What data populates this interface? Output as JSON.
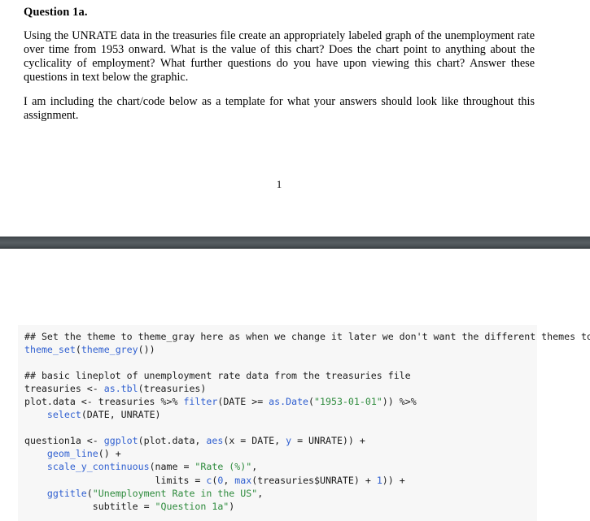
{
  "document": {
    "page_number": "1",
    "heading": "Question 1a.",
    "paragraphs": [
      "Using the UNRATE data in the treasuries file create an appropriately labeled graph of the unemployment rate over time from 1953 onward. What is the value of this chart? Does the chart point to anything about the cyclicality of employment? What further questions do you have upon viewing this chart? Answer these questions in text below the graphic.",
      "I am including the chart/code below as a template for what your answers should look like throughout this assignment."
    ]
  },
  "code_chunk": {
    "language": "r",
    "background_color": "#f7f7f7",
    "comment_color": "#1b1b1b",
    "function_color": "#2f5fd0",
    "string_color": "#2e8b3d",
    "lines": [
      "## Set the theme to theme_gray here as when we change it later we don't want the different themes to",
      "theme_set(theme_grey())",
      "",
      "## basic lineplot of unemployment rate data from the treasuries file",
      "treasuries <- as.tbl(treasuries)",
      "plot.data <- treasuries %>% filter(DATE >= as.Date(\"1953-01-01\")) %>%",
      "    select(DATE, UNRATE)",
      "",
      "question1a <- ggplot(plot.data, aes(x = DATE, y = UNRATE)) +",
      "    geom_line() +",
      "    scale_y_continuous(name = \"Rate (%)\",",
      "                       limits = c(0, max(treasuries$UNRATE) + 1)) +",
      "    ggtitle(\"Unemployment Rate in the US\",",
      "            subtitle = \"Question 1a\")"
    ],
    "tokens": {
      "line0": [
        {
          "t": "## Set the theme to theme_gray here as when we change it later we don't want the different themes to",
          "c": "tok-comment"
        }
      ],
      "line1": [
        {
          "t": "theme_set",
          "c": "tok-fn"
        },
        {
          "t": "(",
          "c": "tok-plain"
        },
        {
          "t": "theme_grey",
          "c": "tok-fn"
        },
        {
          "t": "())",
          "c": "tok-plain"
        }
      ],
      "line2": [
        {
          "t": "",
          "c": "tok-plain"
        }
      ],
      "line3": [
        {
          "t": "## basic lineplot of unemployment rate data from the treasuries file",
          "c": "tok-comment"
        }
      ],
      "line4": [
        {
          "t": "treasuries <- ",
          "c": "tok-plain"
        },
        {
          "t": "as.tbl",
          "c": "tok-fn"
        },
        {
          "t": "(treasuries)",
          "c": "tok-plain"
        }
      ],
      "line5": [
        {
          "t": "plot.data <- treasuries %>% ",
          "c": "tok-plain"
        },
        {
          "t": "filter",
          "c": "tok-fn"
        },
        {
          "t": "(DATE >= ",
          "c": "tok-plain"
        },
        {
          "t": "as.Date",
          "c": "tok-fn"
        },
        {
          "t": "(",
          "c": "tok-plain"
        },
        {
          "t": "\"1953-01-01\"",
          "c": "tok-str"
        },
        {
          "t": ")) %>%",
          "c": "tok-plain"
        }
      ],
      "line6": [
        {
          "t": "    ",
          "c": "tok-plain"
        },
        {
          "t": "select",
          "c": "tok-fn"
        },
        {
          "t": "(DATE, UNRATE)",
          "c": "tok-plain"
        }
      ],
      "line7": [
        {
          "t": "",
          "c": "tok-plain"
        }
      ],
      "line8": [
        {
          "t": "question1a <- ",
          "c": "tok-plain"
        },
        {
          "t": "ggplot",
          "c": "tok-fn"
        },
        {
          "t": "(plot.data, ",
          "c": "tok-plain"
        },
        {
          "t": "aes",
          "c": "tok-fn"
        },
        {
          "t": "(x = DATE, ",
          "c": "tok-plain"
        },
        {
          "t": "y",
          "c": "tok-fn"
        },
        {
          "t": " = UNRATE)) +",
          "c": "tok-plain"
        }
      ],
      "line9": [
        {
          "t": "    ",
          "c": "tok-plain"
        },
        {
          "t": "geom_line",
          "c": "tok-fn"
        },
        {
          "t": "() +",
          "c": "tok-plain"
        }
      ],
      "line10": [
        {
          "t": "    ",
          "c": "tok-plain"
        },
        {
          "t": "scale_y_continuous",
          "c": "tok-fn"
        },
        {
          "t": "(name = ",
          "c": "tok-plain"
        },
        {
          "t": "\"Rate (%)\"",
          "c": "tok-str"
        },
        {
          "t": ",",
          "c": "tok-plain"
        }
      ],
      "line11": [
        {
          "t": "                       limits = ",
          "c": "tok-plain"
        },
        {
          "t": "c",
          "c": "tok-fn"
        },
        {
          "t": "(",
          "c": "tok-plain"
        },
        {
          "t": "0",
          "c": "tok-num"
        },
        {
          "t": ", ",
          "c": "tok-plain"
        },
        {
          "t": "max",
          "c": "tok-fn"
        },
        {
          "t": "(treasuries$UNRATE) + ",
          "c": "tok-plain"
        },
        {
          "t": "1",
          "c": "tok-num"
        },
        {
          "t": ")) +",
          "c": "tok-plain"
        }
      ],
      "line12": [
        {
          "t": "    ",
          "c": "tok-plain"
        },
        {
          "t": "ggtitle",
          "c": "tok-fn"
        },
        {
          "t": "(",
          "c": "tok-plain"
        },
        {
          "t": "\"Unemployment Rate in the US\"",
          "c": "tok-str"
        },
        {
          "t": ",",
          "c": "tok-plain"
        }
      ],
      "line13": [
        {
          "t": "            subtitle = ",
          "c": "tok-plain"
        },
        {
          "t": "\"Question 1a\"",
          "c": "tok-str"
        },
        {
          "t": ")",
          "c": "tok-plain"
        }
      ]
    }
  }
}
